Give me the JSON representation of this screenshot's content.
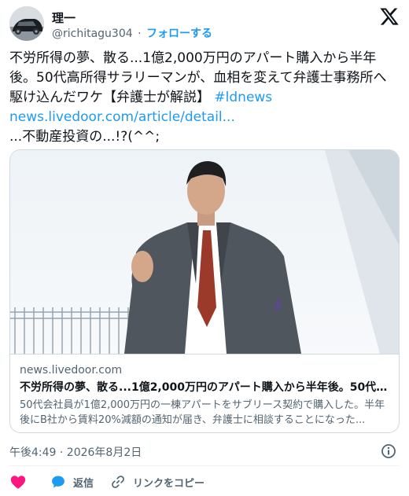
{
  "user": {
    "name": "理一",
    "handle": "@richitagu304",
    "separator": "·",
    "follow_label": "フォローする"
  },
  "tweet": {
    "text": "不労所得の夢、散る...1億2,000万円のアパート購入から半年後。50代高所得サラリーマンが、血相を変えて弁護士事務所へ駆け込んだワケ【弁護士が解説】",
    "hashtag": "#ldnews",
    "link": "news.livedoor.com/article/detail...",
    "comment": "...不動産投資の...!?(^^;"
  },
  "card": {
    "domain": "news.livedoor.com",
    "title": "不労所得の夢、散る...1億2,000万円のアパート購入から半年後。50代高所得...",
    "description": "50代会社員が1億2,000万円の一棟アパートをサブリース契約で購入した。半年後にB社から賃料20%減額の通知が届き、弁護士に相談することになった..."
  },
  "timestamp": "午後4:49 · 2026年8月2日",
  "actions": {
    "reply_label": "返信",
    "copy_link_label": "リンクをコピー"
  },
  "colors": {
    "accent": "#1d9bf0",
    "like": "#f91880",
    "text": "#0f1419",
    "muted": "#536471",
    "border": "#cfd9de"
  },
  "icons": [
    "x-logo-icon",
    "info-icon",
    "heart-icon",
    "reply-bubble-icon",
    "link-icon"
  ]
}
